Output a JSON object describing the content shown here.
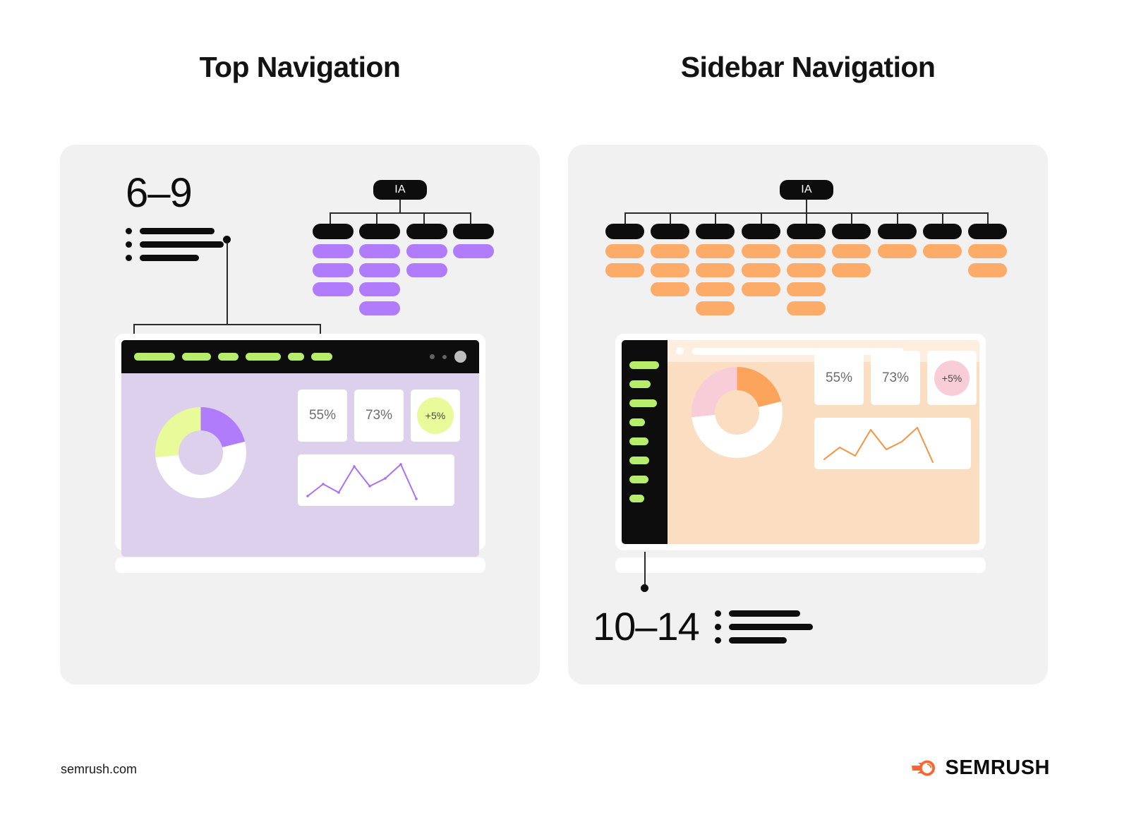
{
  "headings": {
    "left": "Top Navigation",
    "right": "Sidebar Navigation"
  },
  "left_panel": {
    "count_label": "6–9",
    "bullet_lines": 3,
    "tree": {
      "root_label": "IA",
      "columns": [
        {
          "children": 3
        },
        {
          "children": 4
        },
        {
          "children": 2
        },
        {
          "children": 1
        }
      ],
      "child_color": "#b07cfb",
      "root_color": "#0d0d0d"
    },
    "browser": {
      "style": "top-navigation",
      "nav_item_count": 6,
      "nav_item_color": "#b6ee6b",
      "chrome_color": "#0d0d0d",
      "content_bg": "#ddd0ed",
      "window_controls": 3,
      "kpis": [
        {
          "value": "55%",
          "type": "card"
        },
        {
          "value": "73%",
          "type": "card"
        },
        {
          "value": "+5%",
          "type": "badge",
          "badge_color": "#e8fa9a"
        }
      ],
      "donut": {
        "segments": [
          {
            "color": "#b07cfb",
            "percent": 21
          },
          {
            "color": "#ffffff",
            "percent": 52
          },
          {
            "color": "#e8fa9a",
            "percent": 27
          }
        ]
      },
      "line_chart": {
        "accent": "#a970f5",
        "points": [
          5,
          32,
          12,
          78,
          28,
          52,
          85,
          2
        ]
      }
    }
  },
  "right_panel": {
    "count_label": "10–14",
    "bullet_lines": 3,
    "tree": {
      "root_label": "IA",
      "columns": [
        {
          "children": 2
        },
        {
          "children": 3
        },
        {
          "children": 4
        },
        {
          "children": 3
        },
        {
          "children": 4
        },
        {
          "children": 2
        },
        {
          "children": 1
        },
        {
          "children": 1
        },
        {
          "children": 2
        }
      ],
      "child_color": "#fcab68",
      "root_color": "#0d0d0d"
    },
    "browser": {
      "style": "sidebar-navigation",
      "nav_item_count": 8,
      "nav_item_color": "#b6ee6b",
      "rail_color": "#0d0d0d",
      "content_bg": "#fbdec1",
      "urlbar_bg": "#fdeee0",
      "kpis": [
        {
          "value": "55%",
          "type": "card"
        },
        {
          "value": "73%",
          "type": "card"
        },
        {
          "value": "+5%",
          "type": "badge",
          "badge_color": "#f9cdd8"
        }
      ],
      "donut": {
        "segments": [
          {
            "color": "#fca45c",
            "percent": 21
          },
          {
            "color": "#ffffff",
            "percent": 52
          },
          {
            "color": "#f9cdd8",
            "percent": 27
          }
        ]
      },
      "line_chart": {
        "accent": "#f59440",
        "points": [
          5,
          32,
          12,
          78,
          28,
          52,
          85,
          2
        ]
      }
    }
  },
  "footer": {
    "url": "semrush.com",
    "brand": "SEMRUSH",
    "brand_accent": "#ff642d"
  }
}
